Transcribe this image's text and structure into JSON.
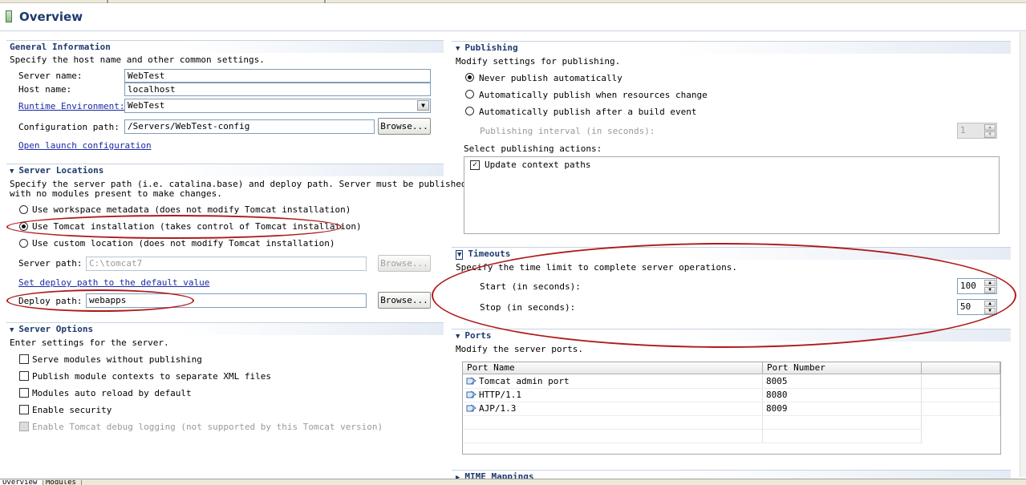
{
  "editor": {
    "title": "Overview",
    "bottom_tabs": [
      "Overview",
      "Modules"
    ]
  },
  "general": {
    "header": "General Information",
    "description": "Specify the host name and other common settings.",
    "server_name_label": "Server name:",
    "server_name_value": "WebTest",
    "host_name_label": "Host name:",
    "host_name_value": "localhost",
    "runtime_label": "Runtime Environment:",
    "runtime_value": "WebTest",
    "config_path_label": "Configuration path:",
    "config_path_value": "/Servers/WebTest-config",
    "browse_label": "Browse...",
    "open_launch_link": "Open launch configuration"
  },
  "locations": {
    "header": "Server Locations",
    "description_line1": "Specify the server path (i.e. catalina.base) and deploy path. Server must be published",
    "description_line2": "with no modules present to make changes.",
    "options": [
      {
        "label": "Use workspace metadata (does not modify Tomcat installation)",
        "selected": false
      },
      {
        "label": "Use Tomcat installation (takes control of Tomcat installation)",
        "selected": true
      },
      {
        "label": "Use custom location (does not modify Tomcat installation)",
        "selected": false
      }
    ],
    "server_path_label": "Server path:",
    "server_path_value": "C:\\tomcat7",
    "browse_label": "Browse...",
    "set_deploy_link": "Set deploy path to the default value",
    "deploy_path_label": "Deploy path:",
    "deploy_path_value": "webapps"
  },
  "options": {
    "header": "Server Options",
    "description": "Enter settings for the server.",
    "items": [
      {
        "label": "Serve modules without publishing",
        "checked": false,
        "enabled": true
      },
      {
        "label": "Publish module contexts to separate XML files",
        "checked": false,
        "enabled": true
      },
      {
        "label": "Modules auto reload by default",
        "checked": false,
        "enabled": true
      },
      {
        "label": "Enable security",
        "checked": false,
        "enabled": true
      },
      {
        "label": "Enable Tomcat debug logging (not supported by this Tomcat version)",
        "checked": false,
        "enabled": false
      }
    ]
  },
  "publishing": {
    "header": "Publishing",
    "description": "Modify settings for publishing.",
    "options": [
      {
        "label": "Never publish automatically",
        "selected": true
      },
      {
        "label": "Automatically publish when resources change",
        "selected": false
      },
      {
        "label": "Automatically publish after a build event",
        "selected": false
      }
    ],
    "interval_label": "Publishing interval (in seconds):",
    "interval_value": "1",
    "actions_label": "Select publishing actions:",
    "actions": [
      {
        "label": "Update context paths",
        "checked": true
      }
    ]
  },
  "timeouts": {
    "header": "Timeouts",
    "description": "Specify the time limit to complete server operations.",
    "start_label": "Start (in seconds):",
    "start_value": "100",
    "stop_label": "Stop (in seconds):",
    "stop_value": "50"
  },
  "ports": {
    "header": "Ports",
    "description": "Modify the server ports.",
    "columns": [
      "Port Name",
      "Port Number"
    ],
    "rows": [
      {
        "name": "Tomcat admin port",
        "number": "8005"
      },
      {
        "name": "HTTP/1.1",
        "number": "8080"
      },
      {
        "name": "AJP/1.3",
        "number": "8009"
      }
    ]
  },
  "mime": {
    "header": "MIME Mappings"
  },
  "colors": {
    "header_text": "#1e3a6e",
    "link": "#1a2aa6",
    "annotation": "#b01a1a"
  }
}
